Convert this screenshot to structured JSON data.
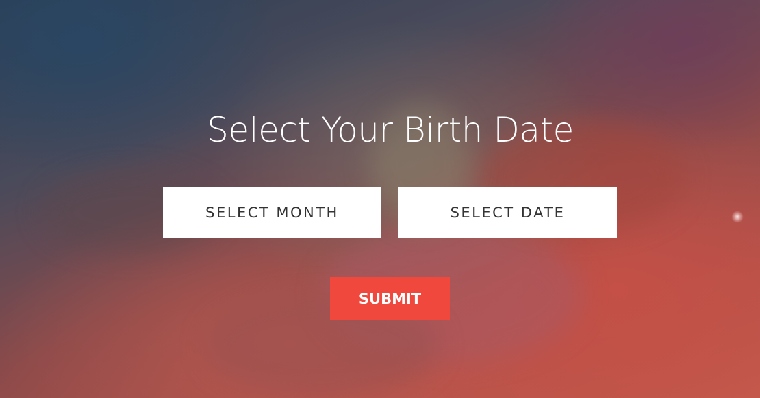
{
  "hero": {
    "title": "Select Your Birth Date",
    "select_month_label": "SELECT MONTH",
    "select_date_label": "SELECT DATE",
    "submit_label": "SUBMIT"
  },
  "colors": {
    "submit_background": "#f1483d",
    "select_background": "#ffffff",
    "select_text": "#333333",
    "title_text": "#ffffff"
  }
}
